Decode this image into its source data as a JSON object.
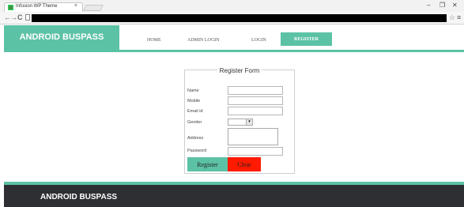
{
  "browser": {
    "tab_title": "Infusion WP Theme",
    "tab_close": "×",
    "minimize": "–",
    "maximize": "❐",
    "close": "✕",
    "back": "←",
    "forward": "→",
    "reload": "C",
    "star": "☆",
    "menu": "≡"
  },
  "site": {
    "logo": "ANDROID BUSPASS",
    "nav": [
      "HOME",
      "ADMIN LOGIN",
      "LOGIN",
      "REGISTER"
    ],
    "active_nav": "REGISTER"
  },
  "form": {
    "title": "Register Form",
    "labels": {
      "name": "Name",
      "mobile": "Mobile",
      "email": "Email id",
      "gender": "Gender",
      "address": "Address",
      "password": "Password"
    },
    "gender_arrow": "▾",
    "register_button": "Register",
    "clear_button": "Clear"
  },
  "footer": {
    "text": "ANDROID BUSPASS"
  },
  "colors": {
    "accent": "#5cc2a5",
    "clear": "#ff1a00",
    "footer": "#2d2f33"
  }
}
